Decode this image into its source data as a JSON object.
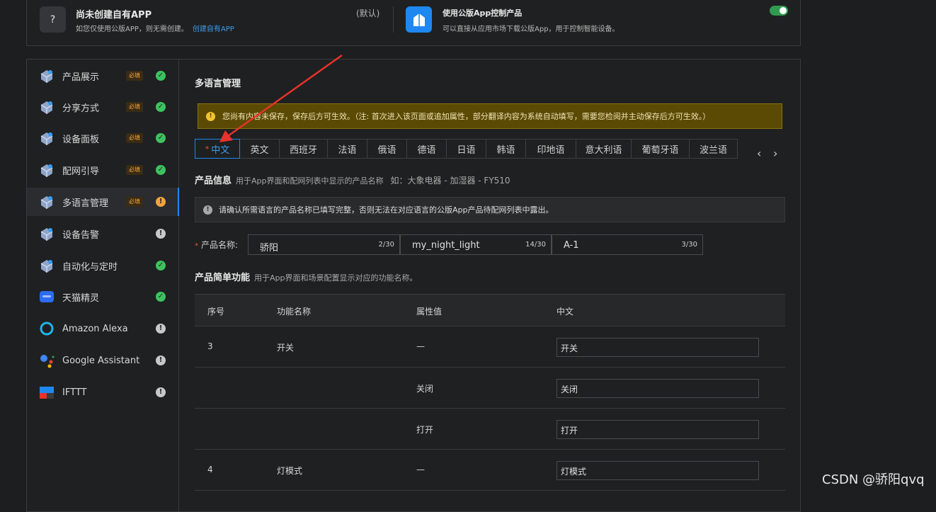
{
  "top_card": {
    "left_icon": "?",
    "left_title": "尚未创建自有APP",
    "left_desc": "如您仅使用公版APP，则无需创建。",
    "left_link": "创建自有APP",
    "default_tag": "(默认)",
    "right_title": "使用公版App控制产品",
    "right_desc": "可以直接从应用市场下载公版App，用于控制智能设备。",
    "toggle_on": true
  },
  "sidebar": {
    "items": [
      {
        "label": "产品展示",
        "required": "必填",
        "status": "ok",
        "icon": "box-icon"
      },
      {
        "label": "分享方式",
        "required": "必填",
        "status": "ok",
        "icon": "share-icon"
      },
      {
        "label": "设备面板",
        "required": "必填",
        "status": "ok",
        "icon": "panel-icon"
      },
      {
        "label": "配网引导",
        "required": "必填",
        "status": "ok",
        "icon": "wifi-icon"
      },
      {
        "label": "多语言管理",
        "required": "必填",
        "status": "warn",
        "icon": "language-icon"
      },
      {
        "label": "设备告警",
        "required": "",
        "status": "info",
        "icon": "alarm-icon"
      },
      {
        "label": "自动化与定时",
        "required": "",
        "status": "ok",
        "icon": "automation-icon"
      },
      {
        "label": "天猫精灵",
        "required": "",
        "status": "ok",
        "icon": "tmall-genie-icon"
      },
      {
        "label": "Amazon Alexa",
        "required": "",
        "status": "info",
        "icon": "alexa-icon"
      },
      {
        "label": "Google Assistant",
        "required": "",
        "status": "info",
        "icon": "google-assistant-icon"
      },
      {
        "label": "IFTTT",
        "required": "",
        "status": "info",
        "icon": "ifttt-icon"
      }
    ],
    "status_glyphs": {
      "ok": "✓",
      "warn": "!",
      "info": "!"
    }
  },
  "content": {
    "title": "多语言管理",
    "alert_icon": "!",
    "alert": "您尚有内容未保存，保存后方可生效。（注: 首次进入该页面或追加属性，部分翻译内容为系统自动填写，需要您检阅并主动保存后方可生效。）",
    "tabs": [
      "中文",
      "英文",
      "西班牙",
      "法语",
      "俄语",
      "德语",
      "日语",
      "韩语",
      "印地语",
      "意大利语",
      "葡萄牙语",
      "波兰语"
    ],
    "active_tab_required": "*",
    "nav_prev": "‹",
    "nav_next": "›",
    "product_info": {
      "title": "产品信息",
      "desc": "用于App界面和配网列表中显示的产品名称",
      "example": "如：大象电器 - 加湿器 - FY510"
    },
    "info_icon": "!",
    "info_notice": "请确认所需语言的产品名称已填写完整，否则无法在对应语言的公版App产品待配网列表中露出。",
    "name_label": "产品名称:",
    "name_required": "*",
    "name_inputs": [
      {
        "value": "骄阳",
        "count": "2/30"
      },
      {
        "value": "my_night_light",
        "count": "14/30"
      },
      {
        "value": "A-1",
        "count": "3/30"
      }
    ],
    "features": {
      "title": "产品简单功能",
      "desc": "用于App界面和场景配置显示对应的功能名称。"
    },
    "table": {
      "headers": [
        "序号",
        "功能名称",
        "属性值",
        "中文"
      ],
      "rows": [
        {
          "no": "3",
          "name": "开关",
          "attr": "—",
          "zh": "开关"
        },
        {
          "no": "",
          "name": "",
          "attr": "关闭",
          "zh": "关闭"
        },
        {
          "no": "",
          "name": "",
          "attr": "打开",
          "zh": "打开"
        },
        {
          "no": "4",
          "name": "灯模式",
          "attr": "—",
          "zh": "灯模式"
        }
      ]
    }
  },
  "watermark": "CSDN @骄阳qvq",
  "colors": {
    "accent": "#1e88f0",
    "ok": "#3cc35f",
    "warn": "#f3a33a",
    "annotation_arrow": "#e8322b"
  }
}
